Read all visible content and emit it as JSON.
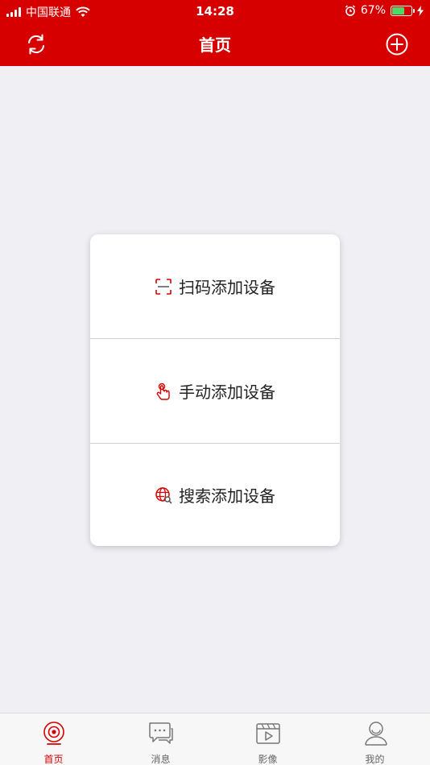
{
  "status_bar": {
    "carrier": "中国联通",
    "time": "14:28",
    "battery": "67%",
    "battery_level": 0.67
  },
  "nav": {
    "title": "首页",
    "left_icon": "refresh-icon",
    "right_icon": "plus-circle-icon"
  },
  "add_menu": {
    "items": [
      {
        "label": "扫码添加设备",
        "icon": "scan-icon"
      },
      {
        "label": "手动添加设备",
        "icon": "hand-touch-icon"
      },
      {
        "label": "搜索添加设备",
        "icon": "globe-search-icon"
      }
    ]
  },
  "tabbar": {
    "tabs": [
      {
        "label": "首页",
        "icon": "camera-icon",
        "active": true
      },
      {
        "label": "消息",
        "icon": "chat-icon",
        "active": false
      },
      {
        "label": "影像",
        "icon": "video-icon",
        "active": false
      },
      {
        "label": "我的",
        "icon": "user-icon",
        "active": false
      }
    ]
  },
  "colors": {
    "brand_red": "#d60000",
    "background": "#efeff4",
    "battery_green": "#4cd964"
  }
}
